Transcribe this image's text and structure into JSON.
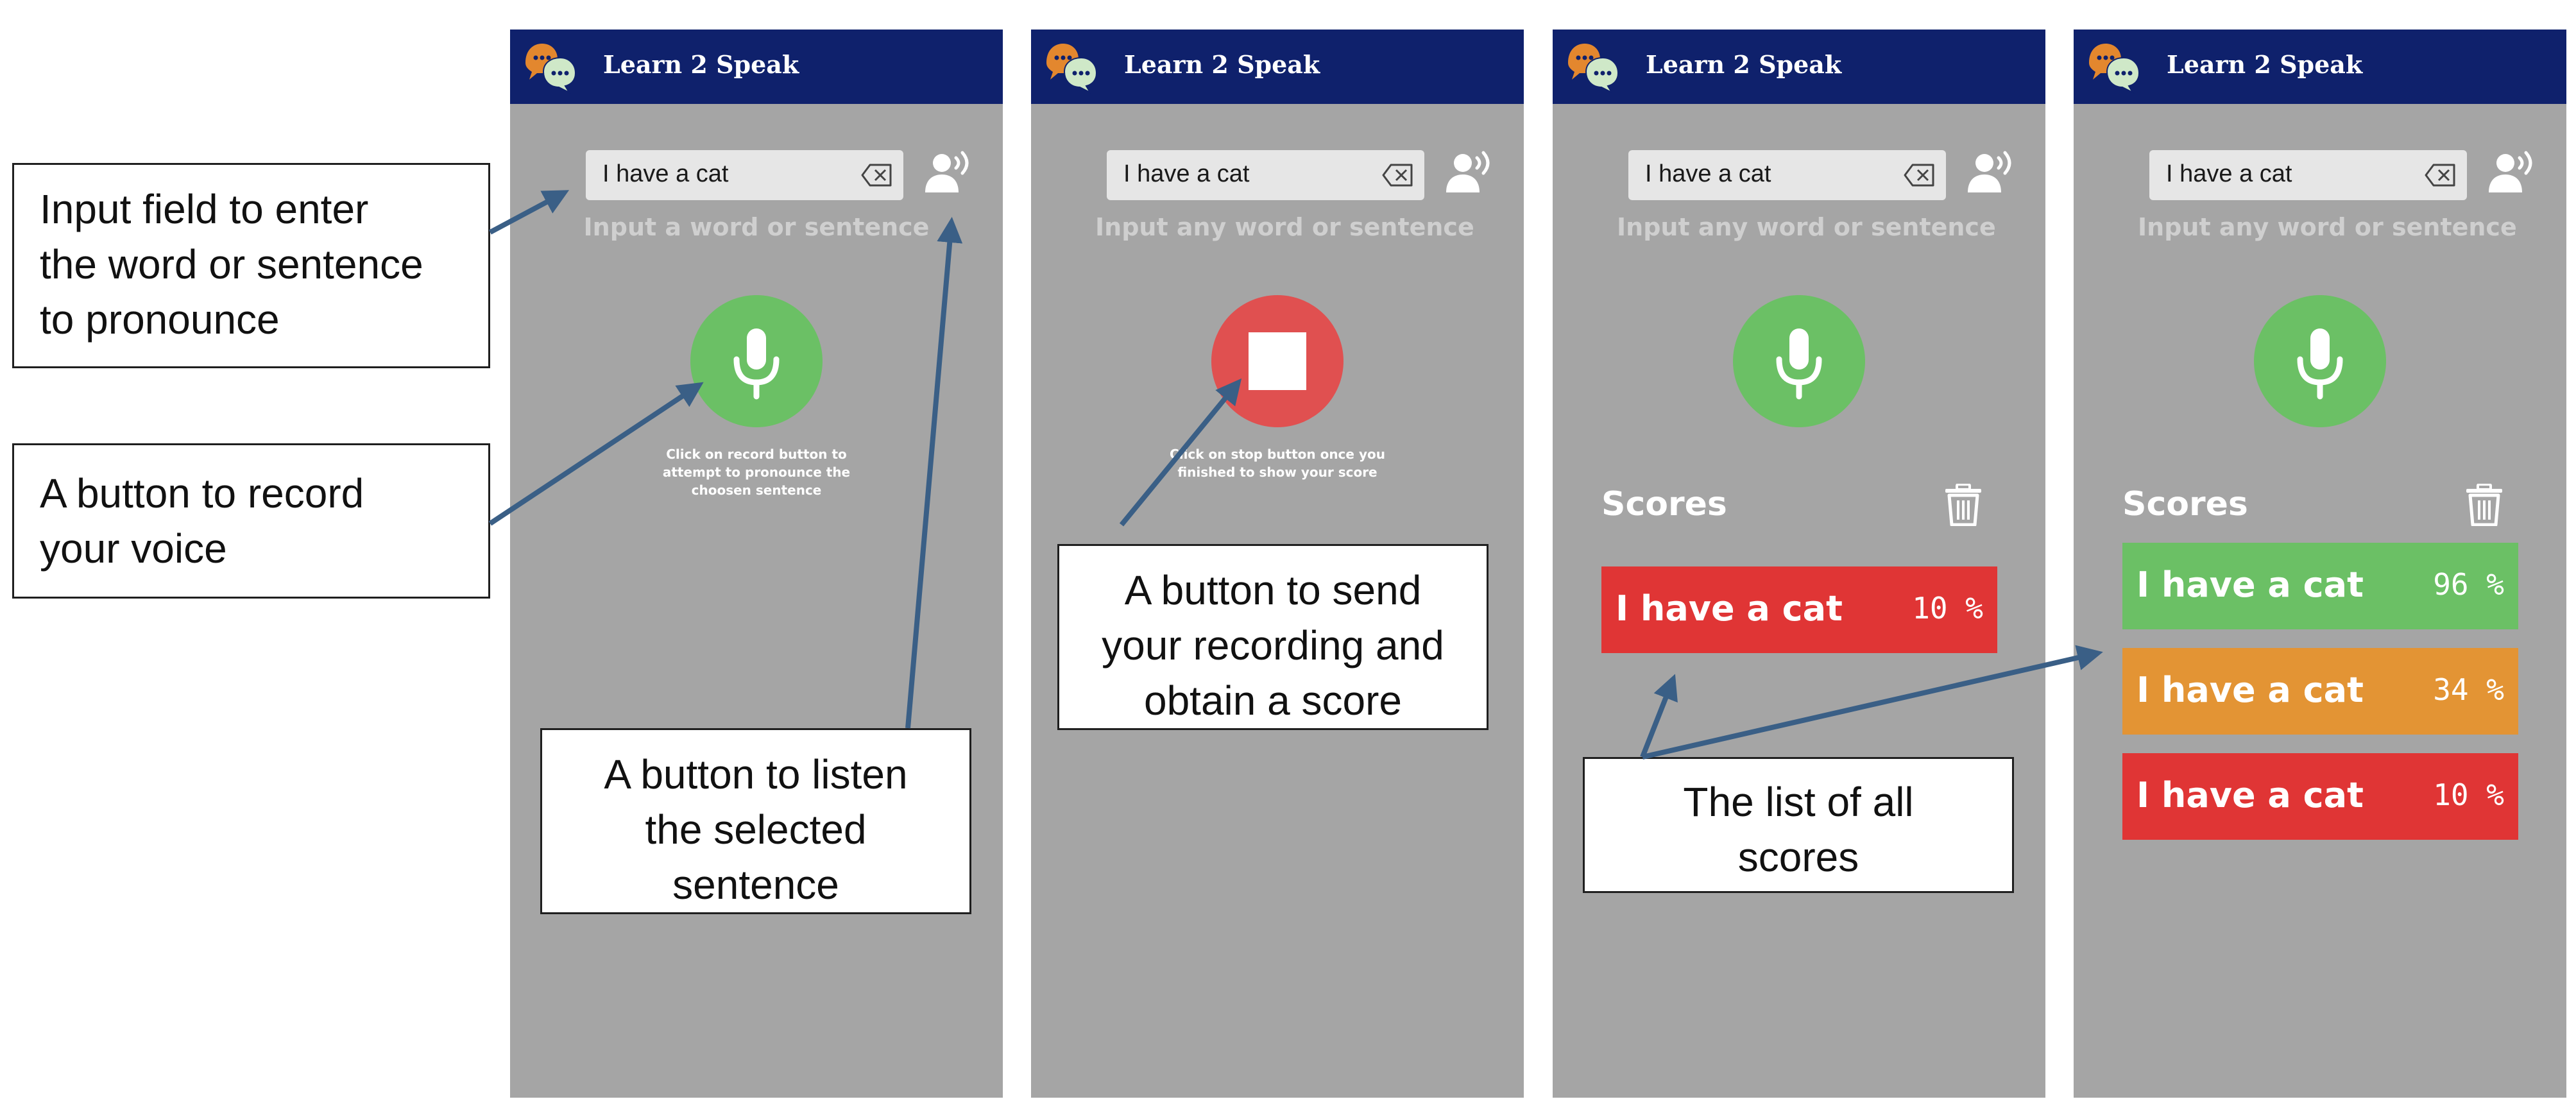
{
  "app": {
    "title": "Learn 2 Speak",
    "colors": {
      "header": "#0f216c",
      "screen_bg": "#a5a5a5",
      "record_green": "#6bc065",
      "stop_red": "#e05050",
      "score_high": "#6bc065",
      "score_mid": "#e39434",
      "score_low": "#e03535"
    }
  },
  "screens": [
    {
      "input_value": "I have a cat",
      "hint": "Input a word or sentence",
      "button_icon": "microphone-icon",
      "instruction": "Click on record button to attempt to pronounce the choosen sentence"
    },
    {
      "input_value": "I have a cat",
      "hint": "Input any word or sentence",
      "button_icon": "stop-icon",
      "instruction": "Click on stop button once you finished to show your score"
    },
    {
      "input_value": "I have a cat",
      "hint": "Input any word or sentence",
      "button_icon": "microphone-icon",
      "scores_title": "Scores",
      "scores": [
        {
          "text": "I have a cat",
          "value": "10 %",
          "level": "low"
        }
      ]
    },
    {
      "input_value": "I have a cat",
      "hint": "Input any word or sentence",
      "button_icon": "microphone-icon",
      "scores_title": "Scores",
      "scores": [
        {
          "text": "I have a cat",
          "value": "96 %",
          "level": "high"
        },
        {
          "text": "I have a cat",
          "value": "34 %",
          "level": "mid"
        },
        {
          "text": "I have a cat",
          "value": "10 %",
          "level": "low"
        }
      ]
    }
  ],
  "callouts": {
    "input_field": [
      "Input field to enter",
      "the word or sentence",
      "to pronounce"
    ],
    "record_button": [
      "A button to record",
      "your voice"
    ],
    "listen_button": [
      "A button to listen",
      "the selected",
      "sentence"
    ],
    "send_button": [
      "A button to send",
      "your recording and",
      "obtain a score"
    ],
    "score_list": [
      "The list of all",
      "scores"
    ]
  }
}
